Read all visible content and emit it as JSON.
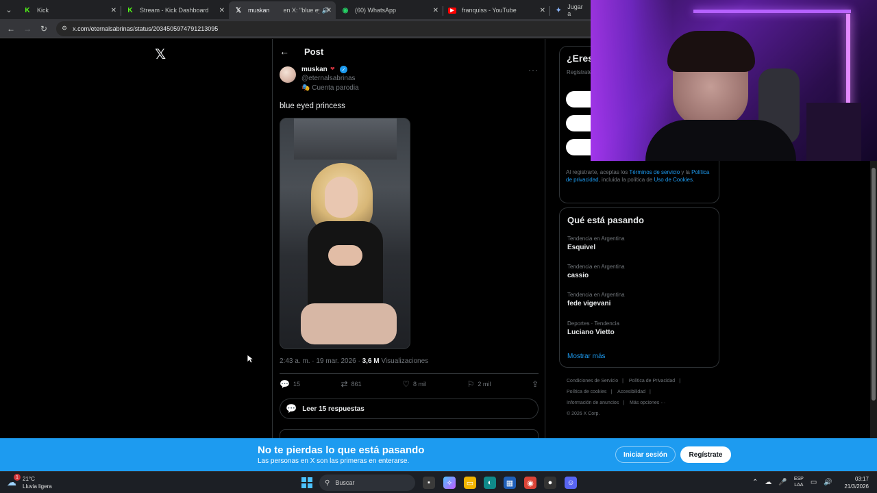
{
  "browser": {
    "tabs": [
      {
        "label": "Kick",
        "icon": "kick-icon",
        "icon_color": "#53fc18"
      },
      {
        "label": "Stream - Kick Dashboard",
        "icon": "kick-icon",
        "icon_color": "#53fc18"
      },
      {
        "label": "muskan",
        "label2": "en X: \"blue eye",
        "icon": "x-icon",
        "icon_color": "#e7e9ea",
        "active": true
      },
      {
        "label": "(60) WhatsApp",
        "icon": "whatsapp-icon",
        "icon_color": "#25d366"
      },
      {
        "label": "franquiss - YouTube",
        "icon": "youtube-icon",
        "icon_color": "#ff0000"
      },
      {
        "label": "Jugar a",
        "icon": "gemini-icon",
        "icon_color": "#8ab4f8"
      }
    ],
    "url": "x.com/eternalsabrinas/status/2034505974791213095"
  },
  "post": {
    "header_title": "Post",
    "author_name": "muskan",
    "author_handle": "@eternalsabrinas",
    "parody_label": "Cuenta parodia",
    "text": "blue eyed princess",
    "time": "2:43 a. m.",
    "date": "19 mar. 2026",
    "views_count": "3,6 M",
    "views_label": "Visualizaciones",
    "replies": "15",
    "reposts": "861",
    "likes": "8 mil",
    "bookmarks": "2 mil",
    "read_replies": "Leer 15 respuestas"
  },
  "signup": {
    "title": "¿Eres",
    "desc": "Regístrate personali",
    "legal_prefix": "Al registrarte, aceptas los ",
    "terms": "Términos de servicio",
    "legal_mid": " y la ",
    "privacy": "Política de privacidad",
    "legal_mid2": ", incluida la política de ",
    "cookies": "Uso de Cookies",
    "legal_end": "."
  },
  "trends": {
    "title": "Qué está pasando",
    "items": [
      {
        "context": "Tendencia en Argentina",
        "name": "Esquivel"
      },
      {
        "context": "Tendencia en Argentina",
        "name": "cassio"
      },
      {
        "context": "Tendencia en Argentina",
        "name": "fede vigevani"
      },
      {
        "context": "Deportes · Tendencia",
        "name": "Luciano Vietto"
      }
    ],
    "show_more": "Mostrar más"
  },
  "footer": {
    "links": [
      "Condiciones de Servicio",
      "Política de Privacidad",
      "Política de cookies",
      "Accesibilidad",
      "Información de anuncios",
      "Más opciones ···"
    ],
    "copyright": "© 2026 X Corp."
  },
  "banner": {
    "title": "No te pierdas lo que está pasando",
    "subtitle": "Las personas en X son las primeras en enterarse.",
    "login": "Iniciar sesión",
    "signup": "Regístrate"
  },
  "taskbar": {
    "weather_temp": "21°C",
    "weather_desc": "Lluvia ligera",
    "weather_badge": "1",
    "search_placeholder": "Buscar",
    "lang_line1": "ESP",
    "lang_line2": "LAA",
    "time": "03:17",
    "date": "21/3/2026"
  },
  "colors": {
    "accent": "#1d9bf0",
    "background": "#000000",
    "border": "#2f3336"
  }
}
